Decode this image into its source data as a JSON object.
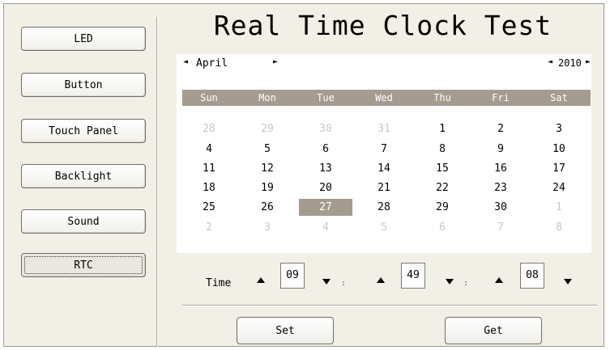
{
  "sidebar": {
    "items": [
      {
        "label": "LED"
      },
      {
        "label": "Button"
      },
      {
        "label": "Touch Panel"
      },
      {
        "label": "Backlight"
      },
      {
        "label": "Sound"
      },
      {
        "label": "RTC",
        "active": true
      }
    ]
  },
  "main": {
    "title": "Real Time Clock Test",
    "calendar": {
      "month": "April",
      "year": "2010",
      "weekdays": [
        "Sun",
        "Mon",
        "Tue",
        "Wed",
        "Thu",
        "Fri",
        "Sat"
      ],
      "weeks": [
        [
          "28",
          "29",
          "30",
          "31",
          "1",
          "2",
          "3"
        ],
        [
          "4",
          "5",
          "6",
          "7",
          "8",
          "9",
          "10"
        ],
        [
          "11",
          "12",
          "13",
          "14",
          "15",
          "16",
          "17"
        ],
        [
          "18",
          "19",
          "20",
          "21",
          "22",
          "23",
          "24"
        ],
        [
          "25",
          "26",
          "27",
          "28",
          "29",
          "30",
          "1"
        ],
        [
          "2",
          "3",
          "4",
          "5",
          "6",
          "7",
          "8"
        ]
      ],
      "selected_day": "27"
    },
    "time": {
      "label": "Time",
      "hour": "09",
      "minute": "49",
      "second": "08",
      "separator": ":"
    },
    "set_label": "Set",
    "get_label": "Get"
  },
  "colors": {
    "header_bar": "#a49c8f",
    "panel_bg": "#f1efe6"
  }
}
